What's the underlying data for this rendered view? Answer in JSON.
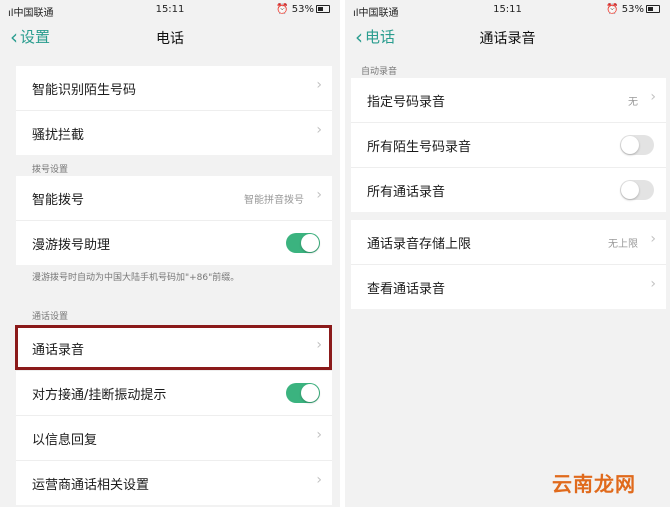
{
  "left": {
    "status": {
      "carrier": "ıl中国联通",
      "time": "15:11",
      "right": "53%"
    },
    "nav": {
      "back_label": "设置",
      "title": "电话"
    },
    "group1": [
      {
        "label": "智能识别陌生号码"
      },
      {
        "label": "骚扰拦截"
      }
    ],
    "section_dial": "拨号设置",
    "group2": [
      {
        "label": "智能拨号",
        "value": "智能拼音拨号"
      },
      {
        "label": "漫游拨号助理",
        "toggle": "on"
      }
    ],
    "roaming_note": "漫游拨号时自动为中国大陆手机号码加\"+86\"前缀。",
    "section_call": "通话设置",
    "group3": [
      {
        "label": "通话录音"
      },
      {
        "label": "对方接通/挂断振动提示",
        "toggle": "on"
      },
      {
        "label": "以信息回复"
      },
      {
        "label": "运营商通话相关设置"
      }
    ]
  },
  "right": {
    "status": {
      "carrier": "ıl中国联通",
      "time": "15:11",
      "right": "53%"
    },
    "nav": {
      "back_label": "电话",
      "title": "通话录音"
    },
    "section_auto": "自动录音",
    "group1": [
      {
        "label": "指定号码录音",
        "value": "无"
      },
      {
        "label": "所有陌生号码录音",
        "toggle": "off"
      },
      {
        "label": "所有通话录音",
        "toggle": "off"
      }
    ],
    "group2": [
      {
        "label": "通话录音存储上限",
        "value": "无上限"
      },
      {
        "label": "查看通话录音"
      }
    ]
  },
  "watermark": "云南龙网",
  "colors": {
    "accent": "#2a9d8f",
    "toggle_on": "#3bb37f",
    "highlight": "#8b1a1a"
  }
}
